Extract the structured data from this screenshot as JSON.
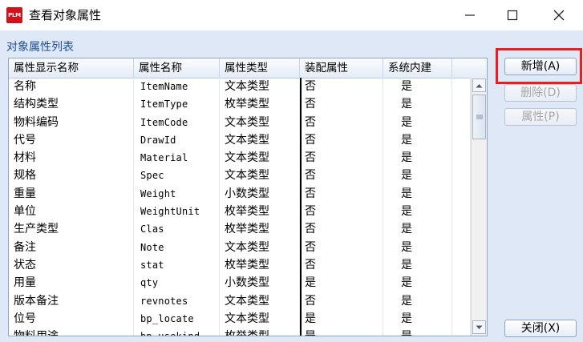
{
  "window": {
    "logo_text": "PLM",
    "title": "查看对象属性",
    "controls": [
      "minimize-icon",
      "maximize-icon",
      "close-icon"
    ]
  },
  "section_label": "对象属性列表",
  "columns": [
    "属性显示名称",
    "属性名称",
    "属性类型",
    "装配属性",
    "系统内建"
  ],
  "rows": [
    [
      "名称",
      "ItemName",
      "文本类型",
      "否",
      "是"
    ],
    [
      "结构类型",
      "ItemType",
      "枚举类型",
      "否",
      "是"
    ],
    [
      "物料编码",
      "ItemCode",
      "文本类型",
      "否",
      "是"
    ],
    [
      "代号",
      "DrawId",
      "文本类型",
      "否",
      "是"
    ],
    [
      "材料",
      "Material",
      "文本类型",
      "否",
      "是"
    ],
    [
      "规格",
      "Spec",
      "文本类型",
      "否",
      "是"
    ],
    [
      "重量",
      "Weight",
      "小数类型",
      "否",
      "是"
    ],
    [
      "单位",
      "WeightUnit",
      "枚举类型",
      "否",
      "是"
    ],
    [
      "生产类型",
      "Clas",
      "枚举类型",
      "否",
      "是"
    ],
    [
      "备注",
      "Note",
      "文本类型",
      "否",
      "是"
    ],
    [
      "状态",
      "stat",
      "枚举类型",
      "否",
      "是"
    ],
    [
      "用量",
      "qty",
      "小数类型",
      "是",
      "是"
    ],
    [
      "版本备注",
      "revnotes",
      "文本类型",
      "否",
      "是"
    ],
    [
      "位号",
      "bp_locate",
      "文本类型",
      "是",
      "是"
    ],
    [
      "物料用途",
      "bp_usekind",
      "枚举类型",
      "是",
      "是"
    ]
  ],
  "buttons": {
    "add": "新增(A)",
    "delete": "删除(D)",
    "properties": "属性(P)",
    "close": "关闭(X)"
  },
  "colors": {
    "client_bg": "#dfe8f6",
    "highlight": "#ee1c1c",
    "section_label": "#1e4f91"
  }
}
